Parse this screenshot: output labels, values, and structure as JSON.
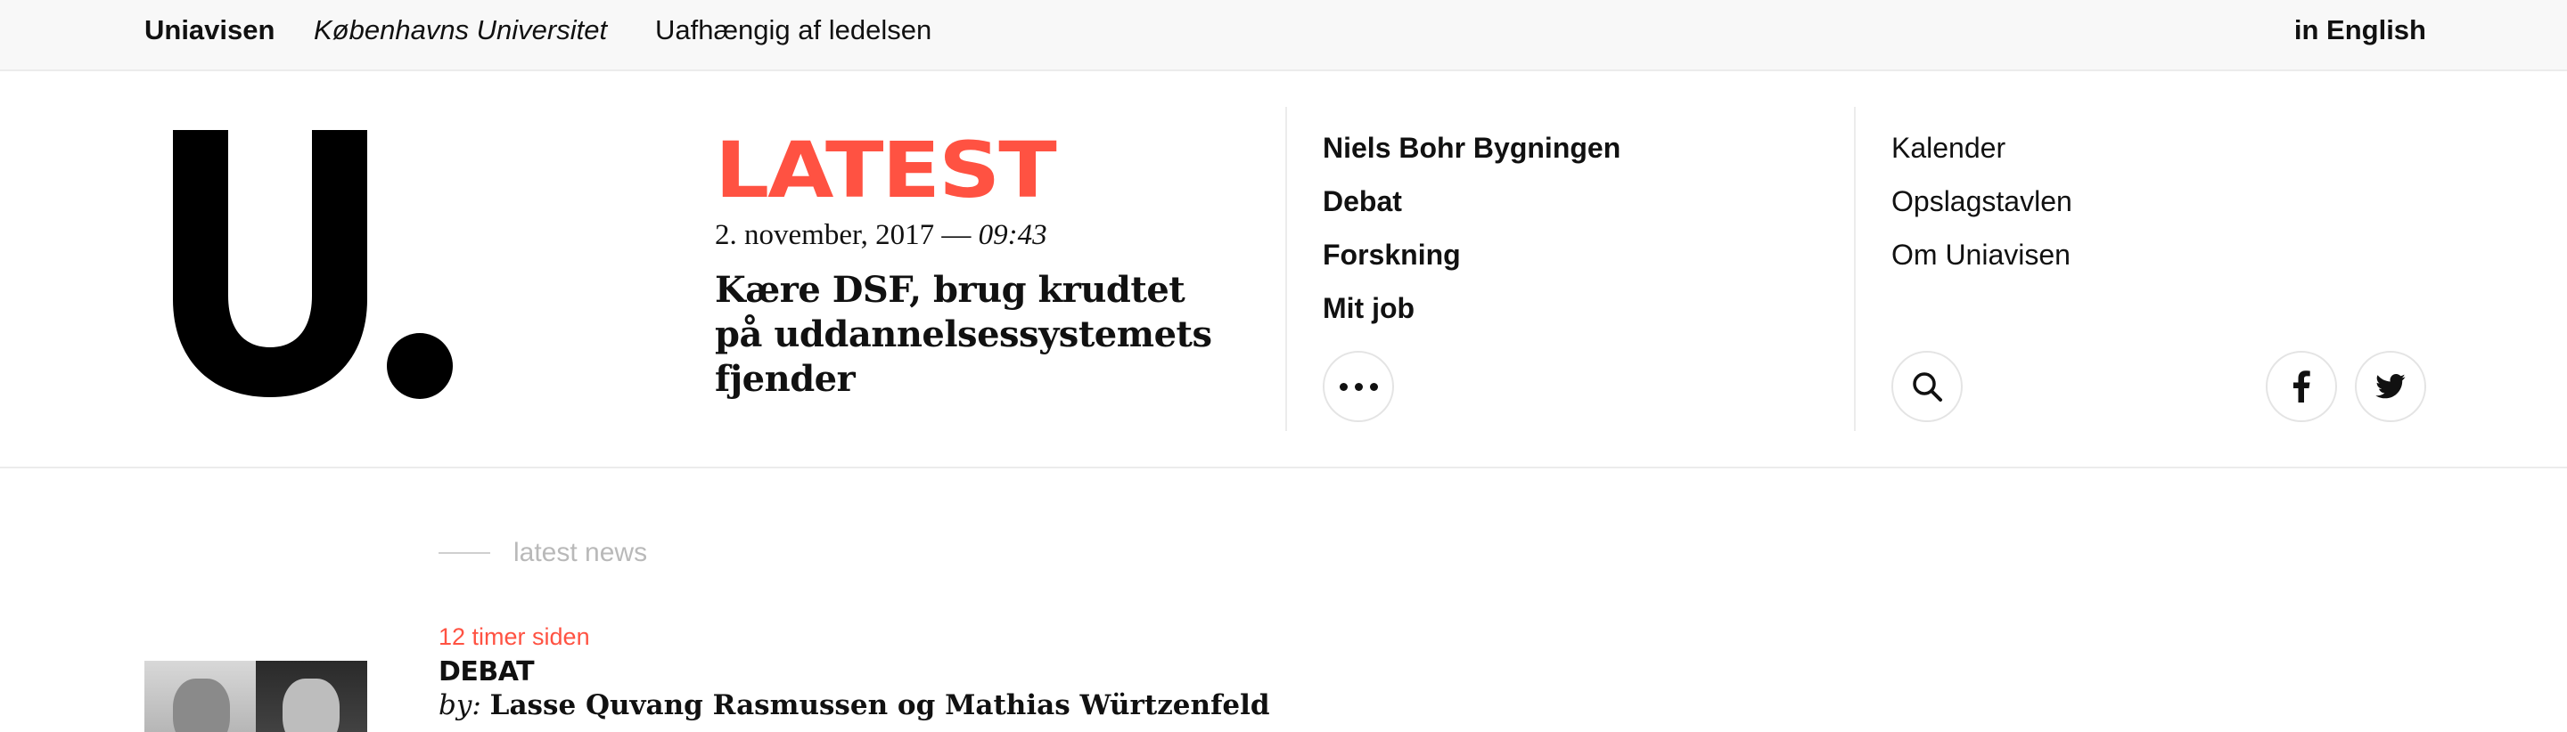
{
  "topbar": {
    "brand": "Uniavisen",
    "university": "Københavns Universitet",
    "tagline": "Uafhængig af ledelsen",
    "language": "in English"
  },
  "logo": {
    "letter": "U."
  },
  "latest": {
    "label": "LATEST",
    "date": "2. november, 2017 —",
    "time": "09:43",
    "headline": "Kære DSF, brug krudtet på uddannelsessystemets fjender"
  },
  "nav": {
    "items": [
      {
        "label": "Niels Bohr Bygningen"
      },
      {
        "label": "Debat"
      },
      {
        "label": "Forskning"
      },
      {
        "label": "Mit job"
      }
    ],
    "more_icon": "more-dots-icon"
  },
  "nav2": {
    "items": [
      {
        "label": "Kalender"
      },
      {
        "label": "Opslagstavlen"
      },
      {
        "label": "Om Uniavisen"
      }
    ],
    "search_icon": "search-icon",
    "social": [
      "facebook-icon",
      "twitter-icon"
    ]
  },
  "news": {
    "section_label": "latest news",
    "article": {
      "time": "12 timer siden",
      "category": "DEBAT",
      "by_label": "by:",
      "authors": "Lasse Quvang Rasmussen og Mathias Würtzenfeld"
    }
  },
  "colors": {
    "accent": "#ff5242",
    "muted": "#b9b9b9",
    "border": "#ececec"
  }
}
